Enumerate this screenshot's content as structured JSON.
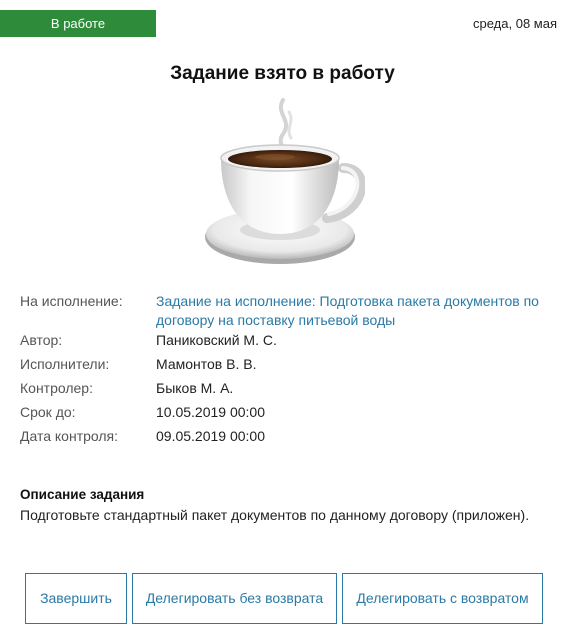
{
  "header": {
    "status": "В работе",
    "date": "среда, 08 мая",
    "status_color": "#2e8b3a"
  },
  "title": "Задание взято в работу",
  "illustration": "coffee-cup-icon",
  "fields": {
    "task_label": "На исполнение:",
    "task_value": "Задание на исполнение: Подготовка пакета документов по договору на поставку питьевой воды",
    "author_label": "Автор:",
    "author_value": "Паниковский М. С.",
    "executors_label": "Исполнители:",
    "executors_value": "Мамонтов В. В.",
    "controller_label": "Контролер:",
    "controller_value": "Быков М. А.",
    "deadline_label": "Срок до:",
    "deadline_value": "10.05.2019 00:00",
    "control_date_label": "Дата контроля:",
    "control_date_value": "09.05.2019 00:00"
  },
  "description": {
    "title": "Описание задания",
    "text": "Подготовьте стандартный пакет документов по данному договору (приложен)."
  },
  "buttons": {
    "finish": "Завершить",
    "delegate_no_return": "Делегировать без возврата",
    "delegate_with_return": "Делегировать с возвратом"
  },
  "colors": {
    "accent": "#2a7aa6",
    "status": "#2e8b3a"
  }
}
